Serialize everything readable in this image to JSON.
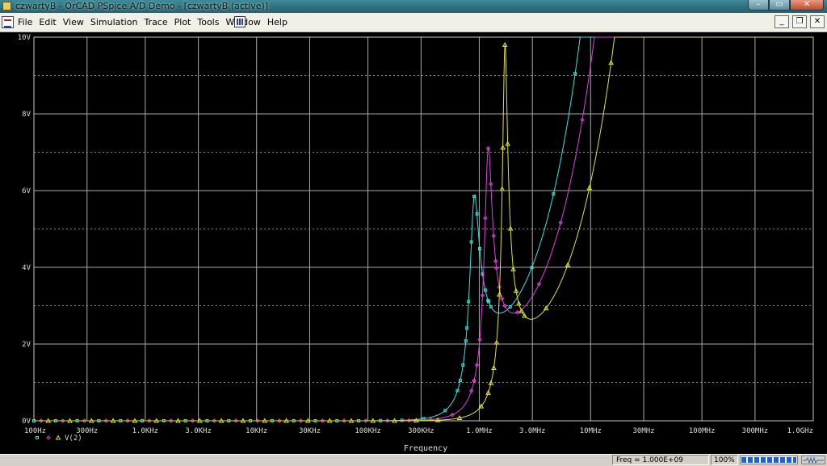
{
  "window": {
    "title": "czwartyB - OrCAD PSpice A/D Demo - [czwartyB (active)]",
    "controls": {
      "minimize": "–",
      "maximize": "▭",
      "close": "✕"
    }
  },
  "menu": {
    "items": [
      "File",
      "Edit",
      "View",
      "Simulation",
      "Trace",
      "Plot",
      "Tools",
      "Window",
      "Help"
    ],
    "mdi_controls": {
      "minimize": "_",
      "restore": "❐",
      "close": "✕"
    }
  },
  "plot": {
    "xlabel": "Frequency",
    "legend_label": "V(2)",
    "x_tick_labels": [
      "100Hz",
      "300Hz",
      "1.0KHz",
      "3.0KHz",
      "10KHz",
      "30KHz",
      "100KHz",
      "300KHz",
      "1.0MHz",
      "3.0MHz",
      "10MHz",
      "30MHz",
      "100MHz",
      "300MHz",
      "1.0GHz"
    ],
    "y_tick_labels": [
      "0V",
      "2V",
      "4V",
      "6V",
      "8V",
      "10V"
    ]
  },
  "chart_data": {
    "type": "line",
    "xlabel": "Frequency",
    "ylabel": "",
    "x_scale": "log",
    "xlim": [
      100,
      1000000000
    ],
    "ylim": [
      0,
      10
    ],
    "x_ticks": [
      100,
      300,
      1000,
      3000,
      10000,
      30000,
      100000,
      300000,
      1000000,
      3000000,
      10000000,
      30000000,
      100000000,
      300000000,
      1000000000
    ],
    "y_ticks": [
      0,
      2,
      4,
      6,
      8,
      10
    ],
    "grid": true,
    "background": "#000000",
    "series": [
      {
        "color": "#40e0e0",
        "marker": "square",
        "f0": 900000,
        "peak": 5.85,
        "q": 5.2
      },
      {
        "color": "#e040e0",
        "marker": "diamond",
        "f0": 1200000,
        "peak": 7.1,
        "q": 6.4
      },
      {
        "color": "#e0e040",
        "marker": "triangle",
        "f0": 1700000,
        "peak": 9.8,
        "q": 9.5
      }
    ],
    "legend_label": "V(2)",
    "legend_position": "bottom-left"
  },
  "status": {
    "freq_text": "Freq = 1.000E+09",
    "zoom_text": "100%",
    "progress": 1.0
  }
}
